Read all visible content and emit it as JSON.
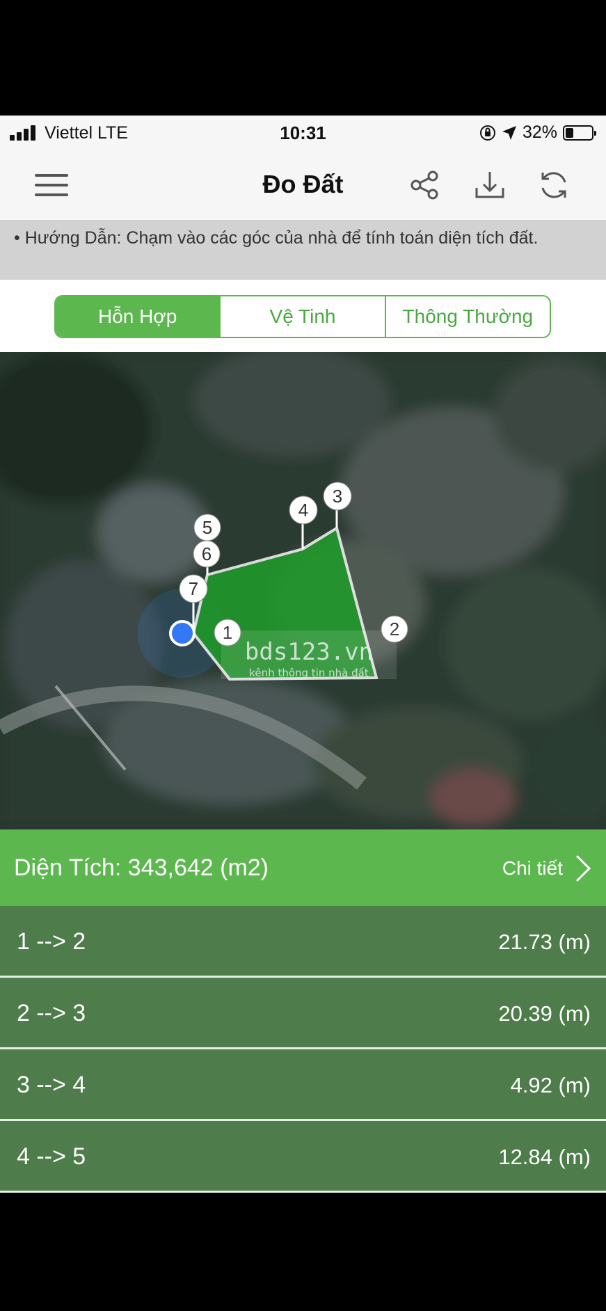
{
  "status_bar": {
    "carrier": "Viettel  LTE",
    "time": "10:31",
    "battery": "32%",
    "battery_level": 0.32
  },
  "header": {
    "title": "Đo Đất",
    "menu_icon": "hamburger-menu-icon",
    "actions": [
      "share-icon",
      "download-icon",
      "refresh-icon"
    ]
  },
  "hint": {
    "text": "• Hướng Dẫn: Chạm vào các góc của nhà để tính toán diện tích đất."
  },
  "map_modes": {
    "options": [
      "Hỗn Hợp",
      "Vệ Tinh",
      "Thông Thường"
    ],
    "selected": "Hỗn Hợp"
  },
  "map": {
    "markers": [
      "1",
      "2",
      "3",
      "4",
      "5",
      "6",
      "7"
    ],
    "watermark_main": "bds123.vn",
    "watermark_sub": "kênh thông tin nhà đất"
  },
  "area": {
    "label": "Diện Tích: 343,642 (m2)",
    "detail_label": "Chi tiết"
  },
  "segments": [
    {
      "label": "1 --> 2",
      "distance": "21.73 (m)"
    },
    {
      "label": "2 --> 3",
      "distance": "20.39 (m)"
    },
    {
      "label": "3 --> 4",
      "distance": "4.92 (m)"
    },
    {
      "label": "4 --> 5",
      "distance": "12.84 (m)"
    }
  ],
  "colors": {
    "accent_green": "#5cb84e",
    "row_green": "#4e7c4a",
    "polygon_green": "#1f9a2a",
    "location_dot": "#3478f6"
  }
}
